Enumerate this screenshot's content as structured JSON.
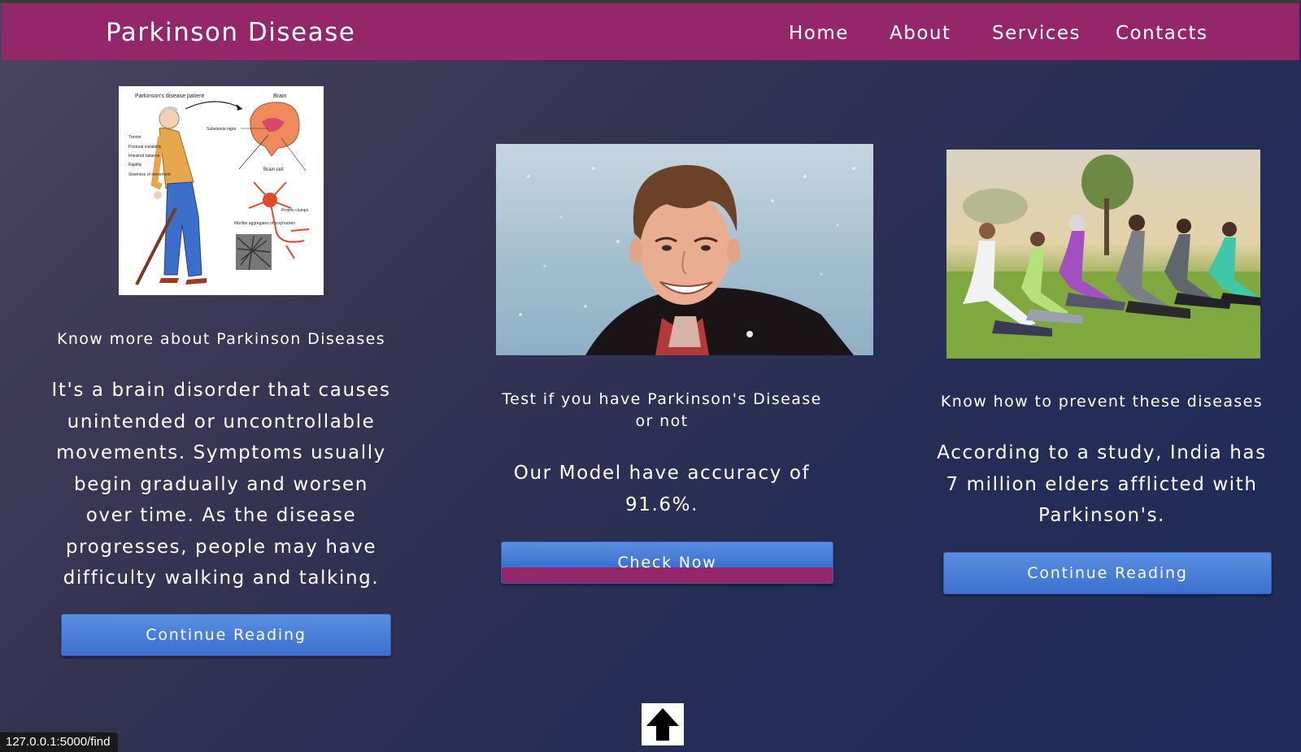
{
  "navbar": {
    "brand": "Parkinson Disease",
    "links": [
      "Home",
      "About",
      "Services",
      "Contacts"
    ]
  },
  "cards": [
    {
      "image_label": "parkinson-diagram-image",
      "diagram_labels": {
        "patient": "Parkinson's disease patient",
        "brain": "Brain",
        "substantia": "Substantia nigra",
        "brain_cell": "Brain cell",
        "tremor": "Tremor",
        "postural": "Postural instability",
        "balance": "Impaired balance",
        "rigidity": "Rigidity",
        "slowness": "Slowness of movement",
        "protein": "Protein clumps",
        "fibrillar": "Fibrillar aggregates of α-synuclein"
      },
      "title": "Know more about Parkinson Diseases",
      "body": "It's a brain disorder that causes unintended or uncontrollable movements. Symptoms usually begin gradually and worsen over time. As the disease progresses, people may have difficulty walking and talking.",
      "button": "Continue Reading"
    },
    {
      "image_label": "person-portrait-image",
      "title": "Test if you have Parkinson's Disease or not",
      "body": "Our Model have accuracy of 91.6%.",
      "button": "Check Now"
    },
    {
      "image_label": "group-yoga-image",
      "title": "Know how to prevent these diseases",
      "body": "According to a study, India has 7 million elders afflicted with Parkinson's.",
      "button": "Continue Reading"
    }
  ],
  "scroll_top_icon": "arrow-up-icon",
  "status_bar": {
    "url": "127.0.0.1:5000/find"
  },
  "colors": {
    "navbar": "#93276a",
    "button": "#4a7fd8",
    "background_start": "#4a4460",
    "background_end": "#1f2c5a"
  }
}
